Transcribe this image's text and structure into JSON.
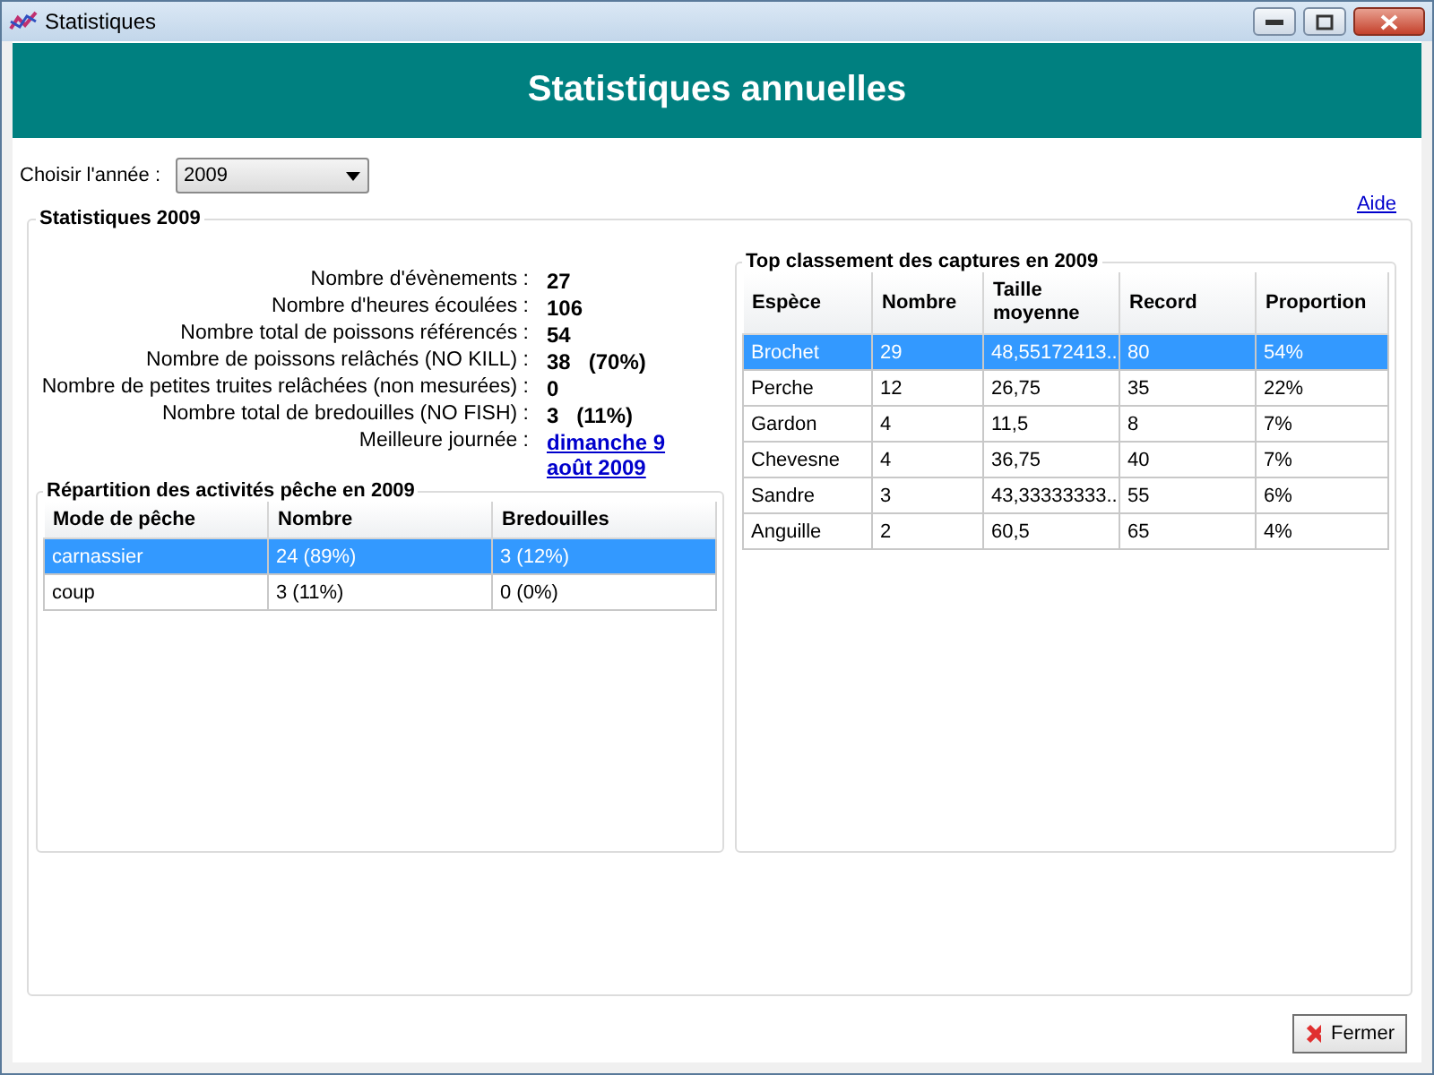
{
  "window": {
    "title": "Statistiques"
  },
  "header": {
    "title": "Statistiques annuelles"
  },
  "year_picker": {
    "label": "Choisir l'année :",
    "value": "2009"
  },
  "help_link": "Aide",
  "stats_group": {
    "title": "Statistiques 2009",
    "rows": [
      {
        "label": "Nombre d'évènements :",
        "value": "27",
        "kind": "text"
      },
      {
        "label": "Nombre d'heures écoulées :",
        "value": "106",
        "kind": "text"
      },
      {
        "label": "Nombre total de poissons référencés :",
        "value": "54",
        "kind": "text"
      },
      {
        "label": "Nombre de poissons relâchés (NO KILL) :",
        "value": "38   (70%)",
        "kind": "text"
      },
      {
        "label": "Nombre de petites truites relâchées (non mesurées) :",
        "value": "0",
        "kind": "text"
      },
      {
        "label": "Nombre total de bredouilles (NO FISH) :",
        "value": "3   (11%)",
        "kind": "text"
      },
      {
        "label": "Meilleure journée :",
        "value": "dimanche 9 août 2009",
        "kind": "link"
      }
    ]
  },
  "activities": {
    "title": "Répartition des activités pêche en 2009",
    "columns": [
      "Mode de pêche",
      "Nombre",
      "Bredouilles"
    ],
    "rows": [
      {
        "cells": [
          "carnassier",
          "24  (89%)",
          "3  (12%)"
        ],
        "selected": true
      },
      {
        "cells": [
          "coup",
          "3  (11%)",
          "0  (0%)"
        ],
        "selected": false
      }
    ]
  },
  "top_catches": {
    "title": "Top classement des captures en 2009",
    "columns": [
      "Espèce",
      "Nombre",
      "Taille moyenne",
      "Record",
      "Proportion"
    ],
    "rows": [
      {
        "cells": [
          "Brochet",
          "29",
          "48,55172413...",
          "80",
          "54%"
        ],
        "selected": true
      },
      {
        "cells": [
          "Perche",
          "12",
          "26,75",
          "35",
          "22%"
        ],
        "selected": false
      },
      {
        "cells": [
          "Gardon",
          "4",
          "11,5",
          "8",
          "7%"
        ],
        "selected": false
      },
      {
        "cells": [
          "Chevesne",
          "4",
          "36,75",
          "40",
          "7%"
        ],
        "selected": false
      },
      {
        "cells": [
          "Sandre",
          "3",
          "43,33333333...",
          "55",
          "6%"
        ],
        "selected": false
      },
      {
        "cells": [
          "Anguille",
          "2",
          "60,5",
          "65",
          "4%"
        ],
        "selected": false
      }
    ]
  },
  "buttons": [
    {
      "label": "Fermer",
      "kind": "close"
    }
  ]
}
